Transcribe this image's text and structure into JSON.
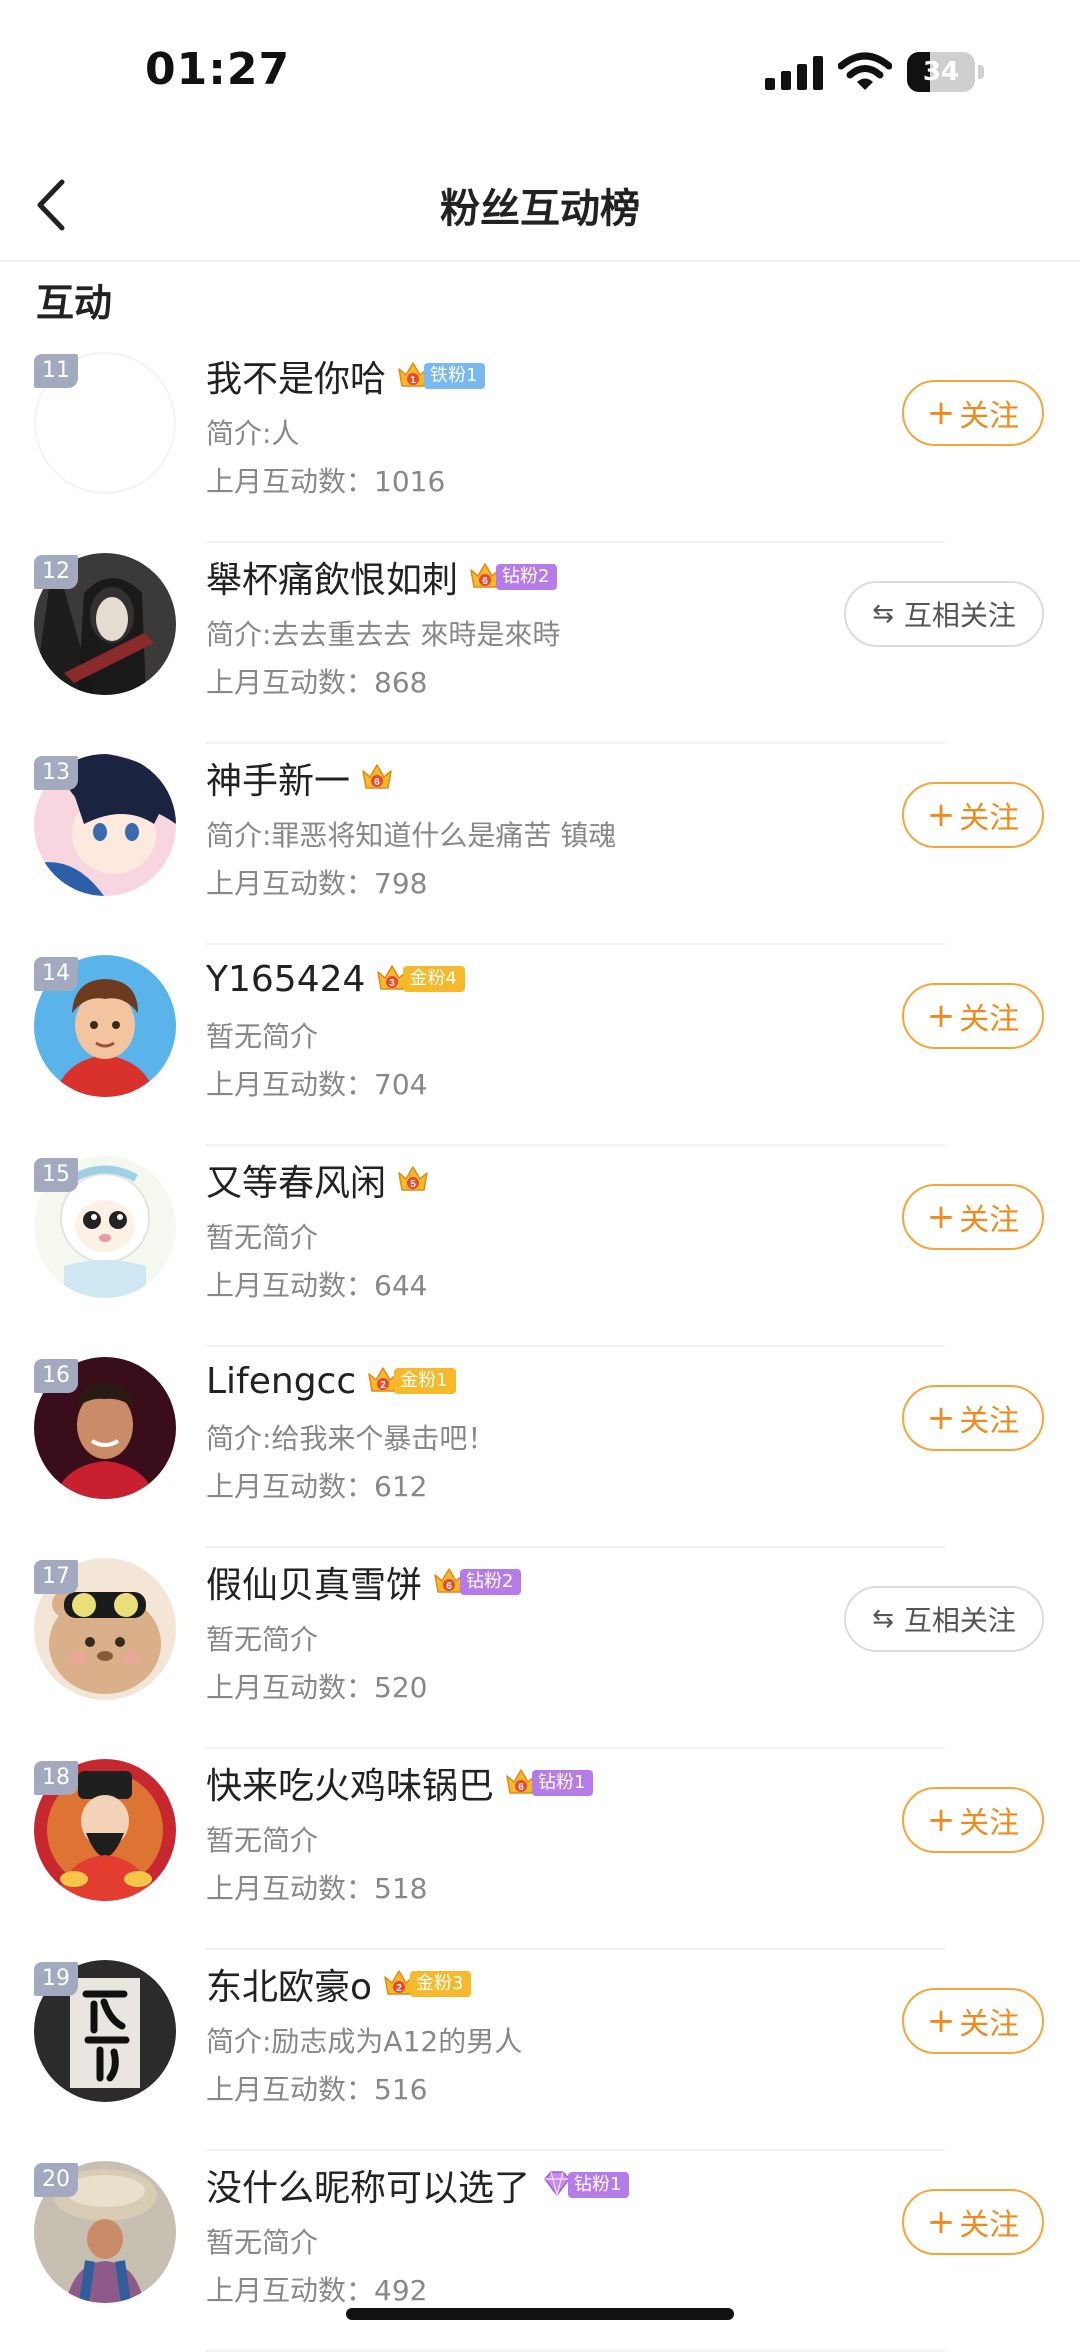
{
  "status_bar": {
    "time": "01:27",
    "battery": "34",
    "battery_fraction": 0.34
  },
  "header": {
    "title": "粉丝互动榜"
  },
  "section": {
    "title": "互动"
  },
  "colors": {
    "accent": "#f08a1d",
    "rank_bg": "#a3a9bf",
    "iron": "#79b8f0",
    "gold": "#f6b92c",
    "diamond": "#b57ce8"
  },
  "fans": [
    {
      "rank": "11",
      "name": "我不是你哈",
      "badge_label": "铁粉1",
      "badge_level": "1",
      "badge_color": "#79b8f0",
      "intro": "简介:人",
      "count_label": "上月互动数：",
      "count": "1016",
      "action": "follow",
      "action_label": "关注",
      "avatar": "blank"
    },
    {
      "rank": "12",
      "name": "舉杯痛飲恨如刺",
      "badge_label": "钻粉2",
      "badge_level": "6",
      "badge_color": "#b57ce8",
      "intro": "简介:去去重去去 來時是來時",
      "count_label": "上月互动数：",
      "count": "868",
      "action": "mutual",
      "action_label": "互相关注",
      "avatar": "dark-art"
    },
    {
      "rank": "13",
      "name": "神手新一",
      "badge_label": "",
      "badge_level": "6",
      "badge_color": "",
      "intro": "简介:罪恶将知道什么是痛苦 镇魂",
      "count_label": "上月互动数：",
      "count": "798",
      "action": "follow",
      "action_label": "关注",
      "avatar": "anime-boy"
    },
    {
      "rank": "14",
      "name": "Y165424",
      "badge_label": "金粉4",
      "badge_level": "3",
      "badge_color": "#f6b92c",
      "intro": "暂无简介",
      "count_label": "上月互动数：",
      "count": "704",
      "action": "follow",
      "action_label": "关注",
      "avatar": "cartoon-boy"
    },
    {
      "rank": "15",
      "name": "又等春风闲",
      "badge_label": "",
      "badge_level": "5",
      "badge_color": "",
      "intro": "暂无简介",
      "count_label": "上月互动数：",
      "count": "644",
      "action": "follow",
      "action_label": "关注",
      "avatar": "sheep"
    },
    {
      "rank": "16",
      "name": "Lifengcc",
      "badge_label": "金粉1",
      "badge_level": "2",
      "badge_color": "#f6b92c",
      "intro": "简介:给我来个暴击吧！",
      "count_label": "上月互动数：",
      "count": "612",
      "action": "follow",
      "action_label": "关注",
      "avatar": "footballer"
    },
    {
      "rank": "17",
      "name": "假仙贝真雪饼",
      "badge_label": "钻粉2",
      "badge_level": "6",
      "badge_color": "#b57ce8",
      "intro": "暂无简介",
      "count_label": "上月互动数：",
      "count": "520",
      "action": "mutual",
      "action_label": "互相关注",
      "avatar": "bear"
    },
    {
      "rank": "18",
      "name": "快来吃火鸡味锅巴",
      "badge_label": "钻粉1",
      "badge_level": "6",
      "badge_color": "#b57ce8",
      "intro": "暂无简介",
      "count_label": "上月互动数：",
      "count": "518",
      "action": "follow",
      "action_label": "关注",
      "avatar": "fortune-god"
    },
    {
      "rank": "19",
      "name": "东北欧豪o",
      "badge_label": "金粉3",
      "badge_level": "2",
      "badge_color": "#f6b92c",
      "intro": "简介:励志成为A12的男人",
      "count_label": "上月互动数：",
      "count": "516",
      "action": "follow",
      "action_label": "关注",
      "avatar": "calligraphy"
    },
    {
      "rank": "20",
      "name": "没什么昵称可以选了",
      "badge_label": "钻粉1",
      "badge_level": "",
      "badge_color": "#b57ce8",
      "intro": "暂无简介",
      "count_label": "上月互动数：",
      "count": "492",
      "action": "follow",
      "action_label": "关注",
      "avatar": "porter"
    }
  ]
}
